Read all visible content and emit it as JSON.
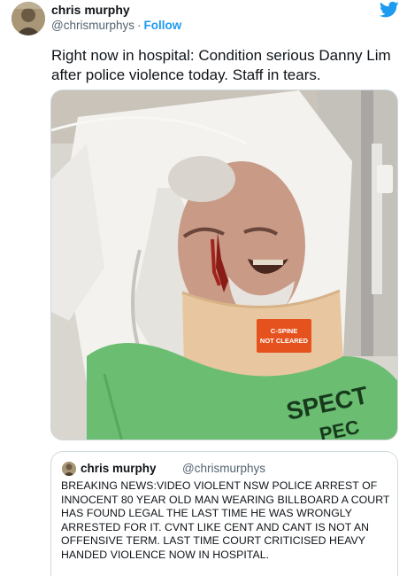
{
  "tweet": {
    "display_name": "chris murphy",
    "handle": "@chrismurphys",
    "separator": "·",
    "follow_label": "Follow",
    "text": "Right now in hospital: Condition serious Danny Lim after police violence today. Staff in tears."
  },
  "photo": {
    "collar_label_line1": "C-SPINE",
    "collar_label_line2": "NOT CLEARED",
    "shirt_text_line1": "SPECT",
    "shirt_text_line2": "PEC"
  },
  "quote": {
    "display_name": "chris murphy",
    "handle": "@chrismurphys",
    "text": "BREAKING NEWS:VIDEO VIOLENT NSW POLICE ARREST OF INNOCENT 80 YEAR OLD MAN WEARING BILLBOARD A COURT HAS FOUND LEGAL THE LAST TIME HE WAS WRONGLY ARRESTED FOR IT. CVNT LIKE CENT AND CANT IS NOT AN OFFENSIVE TERM. LAST TIME COURT CRITICISED HEAVY HANDED VIOLENCE NOW IN HOSPITAL."
  },
  "colors": {
    "link_blue": "#1d9bf0",
    "secondary_text": "#536471",
    "border": "#cfd9de"
  },
  "icons": {
    "brand": "twitter-bird-icon"
  }
}
